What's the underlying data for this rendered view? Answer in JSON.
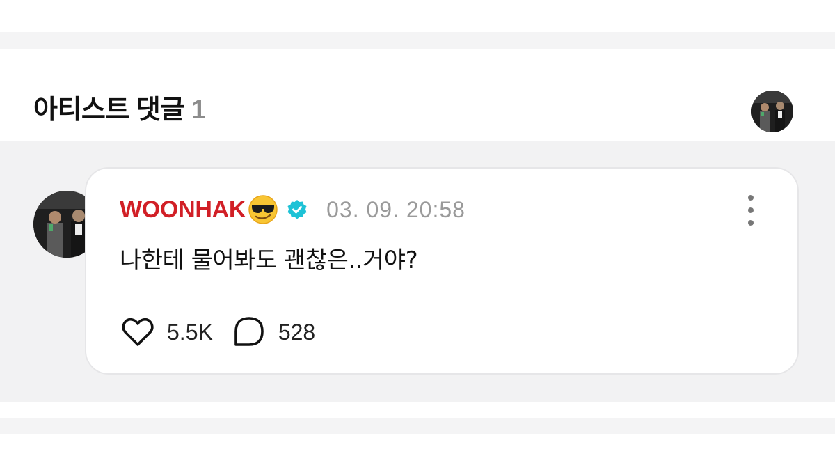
{
  "section": {
    "title": "아티스트 댓글",
    "count": "1"
  },
  "comment": {
    "author": "WOONHAK",
    "author_emoji": "smiling-face-with-sunglasses",
    "verified_icon": "verified-badge-icon",
    "timestamp": "03. 09. 20:58",
    "text": "나한테 물어봐도 괜찮은..거야?",
    "likes": "5.5K",
    "replies": "528"
  },
  "colors": {
    "author_name": "#d11f26",
    "verified": "#1ec2d6",
    "page_bg": "#f2f2f3",
    "card_bg": "#ffffff"
  }
}
